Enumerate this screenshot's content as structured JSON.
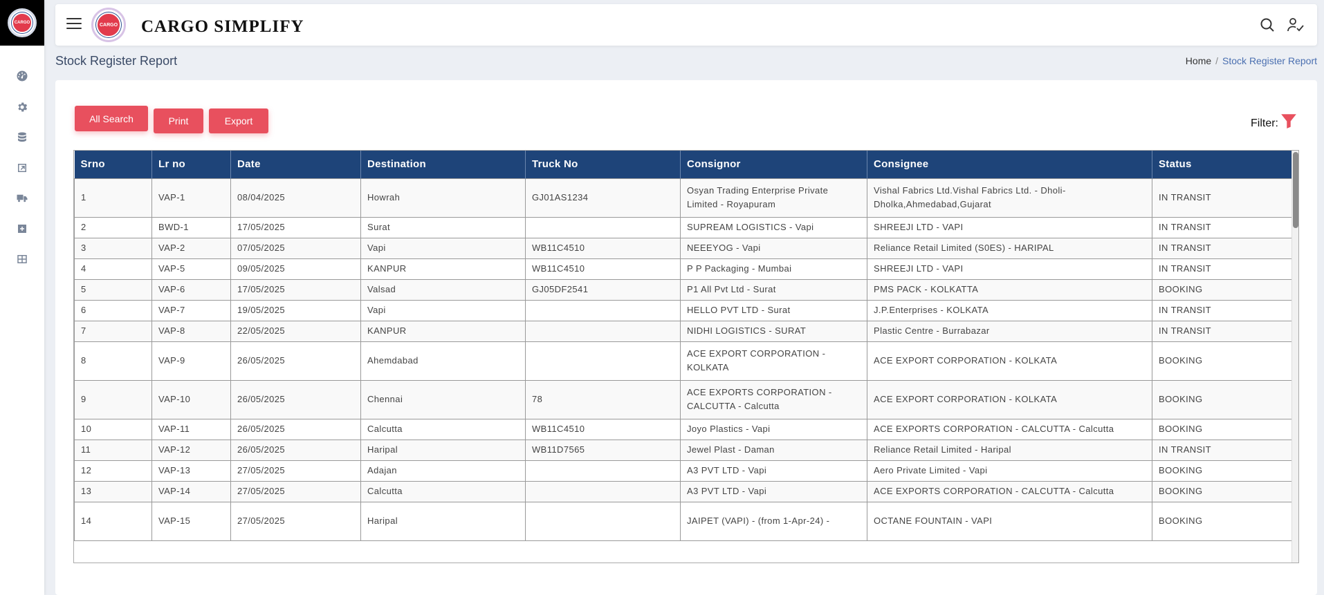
{
  "app": {
    "brand": "CARGO SIMPLIFY",
    "logo_text": "CARGO"
  },
  "colors": {
    "header_bg": "#1e4479",
    "button": "#e8505e",
    "filter": "#e8505e",
    "breadcrumb_active": "#4a6fb0"
  },
  "sidebar": {
    "icons": [
      "dashboard-icon",
      "gear-icon",
      "database-icon",
      "external-link-icon",
      "truck-icon",
      "plus-square-icon",
      "grid-icon"
    ]
  },
  "page": {
    "title": "Stock Register Report"
  },
  "breadcrumb": {
    "home": "Home",
    "separator": "/",
    "current": "Stock Register Report"
  },
  "toolbar": {
    "search_label": "All Search",
    "print_label": "Print",
    "export_label": "Export",
    "filter_label": "Filter:"
  },
  "table": {
    "columns": [
      "Srno",
      "Lr no",
      "Date",
      "Destination",
      "Truck No",
      "Consignor",
      "Consignee",
      "Status"
    ],
    "rows": [
      [
        "1",
        "VAP-1",
        "08/04/2025",
        "Howrah",
        "GJ01AS1234",
        "Osyan Trading Enterprise Private Limited - Royapuram",
        "Vishal Fabrics Ltd.Vishal Fabrics Ltd. - Dholi-Dholka,Ahmedabad,Gujarat",
        "IN TRANSIT"
      ],
      [
        "2",
        "BWD-1",
        "17/05/2025",
        "Surat",
        "",
        "SUPREAM LOGISTICS - Vapi",
        "SHREEJI LTD - VAPI",
        "IN TRANSIT"
      ],
      [
        "3",
        "VAP-2",
        "07/05/2025",
        "Vapi",
        "WB11C4510",
        "NEEEYOG - Vapi",
        "Reliance Retail Limited (S0ES) - HARIPAL",
        "IN TRANSIT"
      ],
      [
        "4",
        "VAP-5",
        "09/05/2025",
        "KANPUR",
        "WB11C4510",
        "P P Packaging - Mumbai",
        "SHREEJI LTD - VAPI",
        "IN TRANSIT"
      ],
      [
        "5",
        "VAP-6",
        "17/05/2025",
        "Valsad",
        "GJ05DF2541",
        "P1 All Pvt Ltd - Surat",
        "PMS PACK - KOLKATTA",
        "BOOKING"
      ],
      [
        "6",
        "VAP-7",
        "19/05/2025",
        "Vapi",
        "",
        "HELLO PVT LTD - Surat",
        "J.P.Enterprises - KOLKATA",
        "IN TRANSIT"
      ],
      [
        "7",
        "VAP-8",
        "22/05/2025",
        "KANPUR",
        "",
        "NIDHI LOGISTICS - SURAT",
        "Plastic Centre - Burrabazar",
        "IN TRANSIT"
      ],
      [
        "8",
        "VAP-9",
        "26/05/2025",
        "Ahemdabad",
        "",
        "ACE EXPORT CORPORATION - KOLKATA",
        "ACE EXPORT CORPORATION - KOLKATA",
        "BOOKING"
      ],
      [
        "9",
        "VAP-10",
        "26/05/2025",
        "Chennai",
        "78",
        "ACE EXPORTS CORPORATION - CALCUTTA - Calcutta",
        "ACE EXPORT CORPORATION - KOLKATA",
        "BOOKING"
      ],
      [
        "10",
        "VAP-11",
        "26/05/2025",
        "Calcutta",
        "WB11C4510",
        "Joyo Plastics - Vapi",
        "ACE EXPORTS CORPORATION - CALCUTTA - Calcutta",
        "BOOKING"
      ],
      [
        "11",
        "VAP-12",
        "26/05/2025",
        "Haripal",
        "WB11D7565",
        "Jewel Plast - Daman",
        "Reliance Retail Limited - Haripal",
        "IN TRANSIT"
      ],
      [
        "12",
        "VAP-13",
        "27/05/2025",
        "Adajan",
        "",
        "A3 PVT LTD - Vapi",
        "Aero Private Limited - Vapi",
        "BOOKING"
      ],
      [
        "13",
        "VAP-14",
        "27/05/2025",
        "Calcutta",
        "",
        "A3 PVT LTD - Vapi",
        "ACE EXPORTS CORPORATION - CALCUTTA - Calcutta",
        "BOOKING"
      ],
      [
        "14",
        "VAP-15",
        "27/05/2025",
        "Haripal",
        "",
        "JAIPET (VAPI) - (from 1-Apr-24) -",
        "OCTANE FOUNTAIN - VAPI",
        "BOOKING"
      ]
    ],
    "tall_rows": [
      0,
      7,
      8,
      13
    ]
  }
}
